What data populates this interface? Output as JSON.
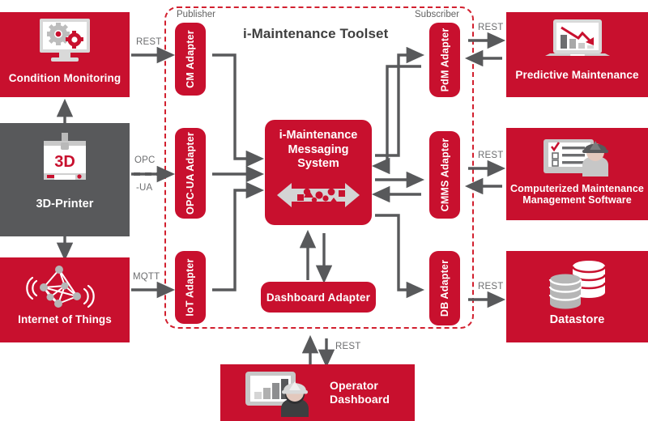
{
  "diagram": {
    "title": "i-Maintenance Toolset",
    "zones": {
      "publisher": "Publisher",
      "subscriber": "Subscriber"
    },
    "colors": {
      "red": "#c8102e",
      "dashed_border": "#d2202f",
      "grey_tile": "#58595b",
      "arrow": "#58595b",
      "text_grey": "#6d6e70"
    }
  },
  "core": {
    "line1": "i-Maintenance",
    "line2": "Messaging",
    "line3": "System",
    "icon": "bidirectional-message-arrow-icon"
  },
  "sources": [
    {
      "id": "condition-monitoring",
      "label": "Condition Monitoring",
      "icon": "monitor-gears-icon",
      "color": "#c8102e"
    },
    {
      "id": "3d-printer",
      "label": "3D-Printer",
      "icon": "3d-printer-icon",
      "color": "#58595b"
    },
    {
      "id": "internet-of-things",
      "label": "Internet of Things",
      "icon": "iot-network-icon",
      "color": "#c8102e"
    }
  ],
  "targets": [
    {
      "id": "predictive-maintenance",
      "label": "Predictive Maintenance",
      "icon": "laptop-chart-icon",
      "color": "#c8102e"
    },
    {
      "id": "cmms",
      "label": "Computerized Maintenance Management Software",
      "label_line1": "Computerized Maintenance",
      "label_line2": "Management Software",
      "icon": "checklist-worker-icon",
      "color": "#c8102e"
    },
    {
      "id": "datastore",
      "label": "Datastore",
      "icon": "database-stack-icon",
      "color": "#c8102e"
    }
  ],
  "bottom": {
    "id": "operator-dashboard",
    "label": "Operator Dashboard",
    "label_line1": "Operator",
    "label_line2": "Dashboard",
    "icon": "dashboard-worker-icon",
    "protocol": "REST"
  },
  "publisher_adapters": [
    {
      "id": "cm-adapter",
      "label": "CM Adapter"
    },
    {
      "id": "opc-ua-adapter",
      "label": "OPC-UA Adapter"
    },
    {
      "id": "iot-adapter",
      "label": "IoT Adapter"
    }
  ],
  "subscriber_adapters": [
    {
      "id": "pdm-adapter",
      "label": "PdM Adapter"
    },
    {
      "id": "cmms-adapter",
      "label": "CMMS Adapter"
    },
    {
      "id": "db-adapter",
      "label": "DB Adapter"
    }
  ],
  "dashboard_adapter": {
    "id": "dashboard-adapter",
    "label": "Dashboard Adapter"
  },
  "protocols": {
    "left_rest": "REST",
    "left_opc": "OPC",
    "left_opc_ua": "-UA",
    "left_mqtt": "MQTT",
    "right_rest_top": "REST",
    "right_rest_mid": "REST",
    "right_rest_bottom": "REST",
    "bottom_rest": "REST"
  }
}
